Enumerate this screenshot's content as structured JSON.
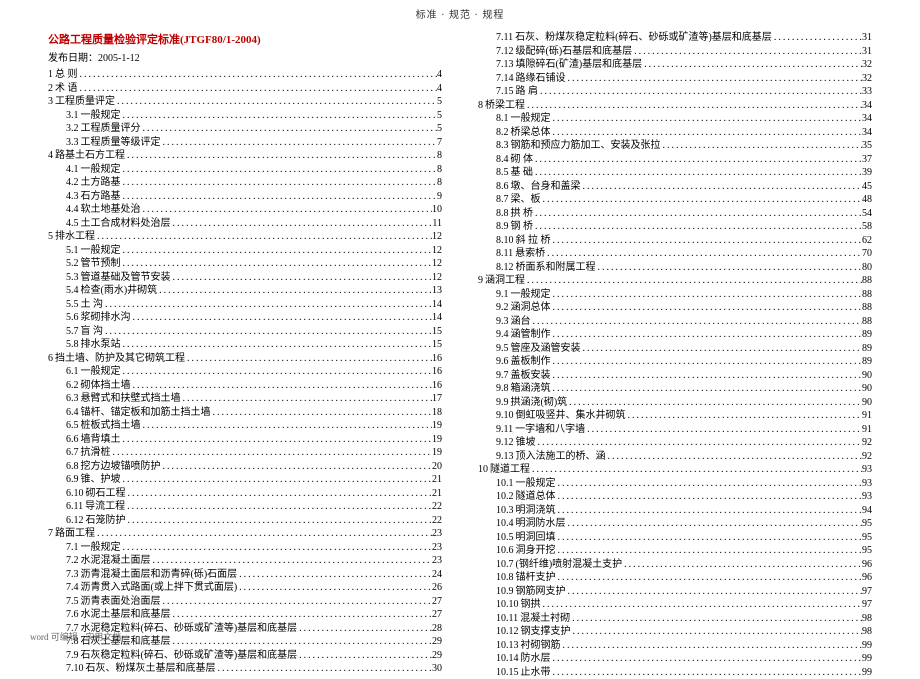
{
  "header": "标准 · 规范 · 规程",
  "title": "公路工程质量检验评定标准(JTGF80/1-2004)",
  "pubdate": "发布日期：2005-1-12",
  "footer": "word 可编辑 · 实用文档",
  "left": [
    {
      "n": "1",
      "t": "总 则",
      "p": "4",
      "i": 0
    },
    {
      "n": "2",
      "t": "术 语",
      "p": "4",
      "i": 0
    },
    {
      "n": "3",
      "t": "工程质量评定",
      "p": "5",
      "i": 0
    },
    {
      "n": "3.1",
      "t": "一般规定",
      "p": "5",
      "i": 1
    },
    {
      "n": "3.2",
      "t": "工程质量评分",
      "p": "5",
      "i": 1
    },
    {
      "n": "3.3",
      "t": "工程质量等级评定",
      "p": "7",
      "i": 1
    },
    {
      "n": "4",
      "t": "路基土石方工程",
      "p": "8",
      "i": 0
    },
    {
      "n": "4.1",
      "t": "一般规定",
      "p": "8",
      "i": 1
    },
    {
      "n": "4.2",
      "t": "土方路基",
      "p": "8",
      "i": 1
    },
    {
      "n": "4.3",
      "t": "石方路基",
      "p": "9",
      "i": 1
    },
    {
      "n": "4.4",
      "t": "软土地基处治",
      "p": "10",
      "i": 1
    },
    {
      "n": "4.5",
      "t": "土工合成材料处治层",
      "p": "11",
      "i": 1
    },
    {
      "n": "5",
      "t": "排水工程",
      "p": "12",
      "i": 0
    },
    {
      "n": "5.1",
      "t": "一般规定",
      "p": "12",
      "i": 1
    },
    {
      "n": "5.2",
      "t": "管节预制",
      "p": "12",
      "i": 1
    },
    {
      "n": "5.3",
      "t": "管道基础及管节安装",
      "p": "12",
      "i": 1
    },
    {
      "n": "5.4",
      "t": "检查(雨水)井砌筑",
      "p": "13",
      "i": 1
    },
    {
      "n": "5.5",
      "t": "土 沟",
      "p": "14",
      "i": 1
    },
    {
      "n": "5.6",
      "t": "浆砌排水沟",
      "p": "14",
      "i": 1
    },
    {
      "n": "5.7",
      "t": "盲 沟",
      "p": "15",
      "i": 1
    },
    {
      "n": "5.8",
      "t": "排水泵站",
      "p": "15",
      "i": 1
    },
    {
      "n": "6",
      "t": "挡土墙、防护及其它砌筑工程",
      "p": "16",
      "i": 0
    },
    {
      "n": "6.1",
      "t": "一般规定",
      "p": "16",
      "i": 1
    },
    {
      "n": "6.2",
      "t": "砌体挡土墙",
      "p": "16",
      "i": 1
    },
    {
      "n": "6.3",
      "t": "悬臂式和扶壁式挡土墙",
      "p": "17",
      "i": 1
    },
    {
      "n": "6.4",
      "t": "锚杆、锚定板和加筋土挡土墙",
      "p": "18",
      "i": 1
    },
    {
      "n": "6.5",
      "t": "桩板式挡土墙",
      "p": "19",
      "i": 1
    },
    {
      "n": "6.6",
      "t": "墙背填土",
      "p": "19",
      "i": 1
    },
    {
      "n": "6.7",
      "t": "抗滑桩",
      "p": "19",
      "i": 1
    },
    {
      "n": "6.8",
      "t": "挖方边坡锚喷防护",
      "p": "20",
      "i": 1
    },
    {
      "n": "6.9",
      "t": "锥、护坡",
      "p": "21",
      "i": 1
    },
    {
      "n": "6.10",
      "t": "砌石工程",
      "p": "21",
      "i": 1
    },
    {
      "n": "6.11",
      "t": "导流工程",
      "p": "22",
      "i": 1
    },
    {
      "n": "6.12",
      "t": "石笼防护",
      "p": "22",
      "i": 1
    },
    {
      "n": "7",
      "t": "路面工程",
      "p": "23",
      "i": 0
    },
    {
      "n": "7.1",
      "t": "一般规定",
      "p": "23",
      "i": 1
    },
    {
      "n": "7.2",
      "t": "水泥混凝土面层",
      "p": "23",
      "i": 1
    },
    {
      "n": "7.3",
      "t": "沥青混凝土面层和沥青碎(砾)石面层",
      "p": "24",
      "i": 1
    },
    {
      "n": "7.4",
      "t": "沥青贯入式路面(或上拌下贯式面层)",
      "p": "26",
      "i": 1
    },
    {
      "n": "7.5",
      "t": "沥青表面处治面层",
      "p": "27",
      "i": 1
    },
    {
      "n": "7.6",
      "t": "水泥土基层和底基层",
      "p": "27",
      "i": 1
    },
    {
      "n": "7.7",
      "t": "水泥稳定粒料(碎石、砂砾或矿渣等)基层和底基层",
      "p": "28",
      "i": 1
    },
    {
      "n": "7.8",
      "t": "石灰土基层和底基层",
      "p": "29",
      "i": 1
    },
    {
      "n": "7.9",
      "t": "石灰稳定粒料(碎石、砂砾或矿渣等)基层和底基层",
      "p": "29",
      "i": 1
    },
    {
      "n": "7.10",
      "t": "石灰、粉煤灰土基层和底基层",
      "p": "30",
      "i": 1
    }
  ],
  "right": [
    {
      "n": "7.11",
      "t": "石灰、粉煤灰稳定粒料(碎石、砂砾或矿渣等)基层和底基层",
      "p": "31",
      "i": 1
    },
    {
      "n": "7.12",
      "t": "级配碎(砾)石基层和底基层",
      "p": "31",
      "i": 1
    },
    {
      "n": "7.13",
      "t": "填隙碎石(矿渣)基层和底基层",
      "p": "32",
      "i": 1
    },
    {
      "n": "7.14",
      "t": "路缘石铺设",
      "p": "32",
      "i": 1
    },
    {
      "n": "7.15",
      "t": "路 肩",
      "p": "33",
      "i": 1
    },
    {
      "n": "8",
      "t": "桥梁工程",
      "p": "34",
      "i": 0
    },
    {
      "n": "8.1",
      "t": "一般规定",
      "p": "34",
      "i": 1
    },
    {
      "n": "8.2",
      "t": "桥梁总体",
      "p": "34",
      "i": 1
    },
    {
      "n": "8.3",
      "t": "钢筋和预应力筋加工、安装及张拉",
      "p": "35",
      "i": 1
    },
    {
      "n": "8.4",
      "t": "砌 体",
      "p": "37",
      "i": 1
    },
    {
      "n": "8.5",
      "t": "基 础",
      "p": "39",
      "i": 1
    },
    {
      "n": "8.6",
      "t": "墩、台身和盖梁",
      "p": "45",
      "i": 1
    },
    {
      "n": "8.7",
      "t": "梁、板",
      "p": "48",
      "i": 1
    },
    {
      "n": "8.8",
      "t": "拱 桥",
      "p": "54",
      "i": 1
    },
    {
      "n": "8.9",
      "t": "钢 桥",
      "p": "58",
      "i": 1
    },
    {
      "n": "8.10",
      "t": "斜 拉 桥",
      "p": "62",
      "i": 1
    },
    {
      "n": "8.11",
      "t": "悬索桥",
      "p": "70",
      "i": 1
    },
    {
      "n": "8.12",
      "t": "桥面系和附属工程",
      "p": "80",
      "i": 1
    },
    {
      "n": "9",
      "t": "涵洞工程",
      "p": "88",
      "i": 0
    },
    {
      "n": "9.1",
      "t": "一般规定",
      "p": "88",
      "i": 1
    },
    {
      "n": "9.2",
      "t": "涵洞总体",
      "p": "88",
      "i": 1
    },
    {
      "n": "9.3",
      "t": "涵台",
      "p": "88",
      "i": 1
    },
    {
      "n": "9.4",
      "t": "涵管制作",
      "p": "89",
      "i": 1
    },
    {
      "n": "9.5",
      "t": "管座及涵管安装",
      "p": "89",
      "i": 1
    },
    {
      "n": "9.6",
      "t": "盖板制作",
      "p": "89",
      "i": 1
    },
    {
      "n": "9.7",
      "t": "盖板安装",
      "p": "90",
      "i": 1
    },
    {
      "n": "9.8",
      "t": "箱涵浇筑",
      "p": "90",
      "i": 1
    },
    {
      "n": "9.9",
      "t": "拱涵浇(砌)筑",
      "p": "90",
      "i": 1
    },
    {
      "n": "9.10",
      "t": "倒虹吸竖井、集水井砌筑",
      "p": "91",
      "i": 1
    },
    {
      "n": "9.11",
      "t": "一字墙和八字墙",
      "p": "91",
      "i": 1
    },
    {
      "n": "9.12",
      "t": "锥坡",
      "p": "92",
      "i": 1
    },
    {
      "n": "9.13",
      "t": "顶入法施工的桥、涵",
      "p": "92",
      "i": 1
    },
    {
      "n": "10",
      "t": "隧道工程",
      "p": "93",
      "i": 0
    },
    {
      "n": "10.1",
      "t": "一般规定",
      "p": "93",
      "i": 1
    },
    {
      "n": "10.2",
      "t": "隧道总体",
      "p": "93",
      "i": 1
    },
    {
      "n": "10.3",
      "t": "明洞浇筑",
      "p": "94",
      "i": 1
    },
    {
      "n": "10.4",
      "t": "明洞防水层",
      "p": "95",
      "i": 1
    },
    {
      "n": "10.5",
      "t": "明洞回填",
      "p": "95",
      "i": 1
    },
    {
      "n": "10.6",
      "t": "洞身开挖",
      "p": "95",
      "i": 1
    },
    {
      "n": "10.7",
      "t": "(钢纤维)喷射混凝土支护",
      "p": "96",
      "i": 1
    },
    {
      "n": "10.8",
      "t": "锚杆支护",
      "p": "96",
      "i": 1
    },
    {
      "n": "10.9",
      "t": "钢筋网支护",
      "p": "97",
      "i": 1
    },
    {
      "n": "10.10",
      "t": "钢拱",
      "p": "97",
      "i": 1
    },
    {
      "n": "10.11",
      "t": "混凝土衬砌",
      "p": "98",
      "i": 1
    },
    {
      "n": "10.12",
      "t": "钢支撑支护",
      "p": "98",
      "i": 1
    },
    {
      "n": "10.13",
      "t": "衬砌钢筋",
      "p": "99",
      "i": 1
    },
    {
      "n": "10.14",
      "t": "防水层",
      "p": "99",
      "i": 1
    },
    {
      "n": "10.15",
      "t": "止水带",
      "p": "99",
      "i": 1
    }
  ]
}
